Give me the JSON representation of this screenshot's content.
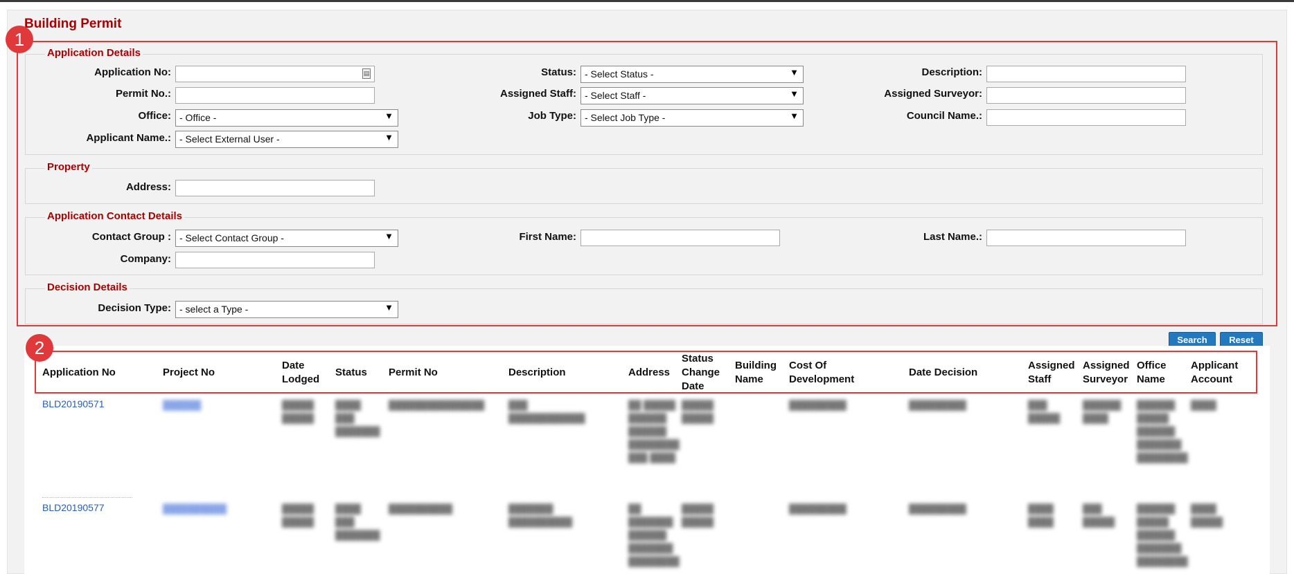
{
  "page": {
    "title": "Building Permit"
  },
  "annotations": [
    "1",
    "2"
  ],
  "application_details": {
    "legend": "Application Details",
    "fields": {
      "application_no": "Application No:",
      "permit_no": "Permit No.:",
      "office": "Office:",
      "applicant_name": "Applicant Name.:",
      "status": "Status:",
      "assigned_staff": "Assigned Staff:",
      "job_type": "Job Type:",
      "description": "Description:",
      "assigned_surveyor": "Assigned Surveyor:",
      "council_name": "Council Name.:"
    },
    "selects": {
      "office": "- Office -",
      "applicant_name": "- Select External User -",
      "status": "- Select Status -",
      "assigned_staff": "- Select Staff -",
      "job_type": "- Select Job Type -"
    }
  },
  "property": {
    "legend": "Property",
    "address_label": "Address:"
  },
  "contact_details": {
    "legend": "Application Contact Details",
    "contact_group_label": "Contact Group :",
    "contact_group_value": "- Select Contact Group -",
    "first_name_label": "First Name:",
    "last_name_label": "Last Name.:",
    "company_label": "Company:"
  },
  "decision_details": {
    "legend": "Decision Details",
    "decision_type_label": "Decision Type:",
    "decision_type_value": "- select a Type -"
  },
  "buttons": {
    "search": "Search",
    "reset": "Reset"
  },
  "table": {
    "columns": [
      "Application No",
      "Project No",
      "Date Lodged",
      "Status",
      "Permit No",
      "Description",
      "Address",
      "Status Change Date",
      "Building Name",
      "Cost Of Development",
      "Date Decision",
      "Assigned Staff",
      "Assigned Surveyor",
      "Office Name",
      "Applicant Account"
    ],
    "rows": [
      {
        "application_no": "BLD20190571",
        "project_no": "██████",
        "date_lodged": "█████ █████",
        "status": "████ ███ ███████",
        "permit_no": "███████████████",
        "description": "███ ████████████",
        "address": "██ █████ ██████ ██████ ████████ ███ ████",
        "status_change_date": "█████ █████",
        "cost": "█████████",
        "date_decision": "█████████",
        "assigned_staff": "███ █████",
        "assigned_surveyor": "██████ ████",
        "office_name": "██████ █████ ██████ ███████ ████████",
        "applicant_account": "████"
      },
      {
        "application_no": "BLD20190577",
        "project_no": "██████████",
        "date_lodged": "█████ █████",
        "status": "████ ███ ███████",
        "permit_no": "██████████",
        "description": "███████ ██████████",
        "address": "██ ███████ ██████ ███████ ████████",
        "status_change_date": "█████ █████",
        "cost": "█████████",
        "date_decision": "█████████",
        "assigned_staff": "████ ████",
        "assigned_surveyor": "███ █████",
        "office_name": "██████ █████ ██████ ███████ ████████",
        "applicant_account": "████ █████"
      }
    ]
  }
}
